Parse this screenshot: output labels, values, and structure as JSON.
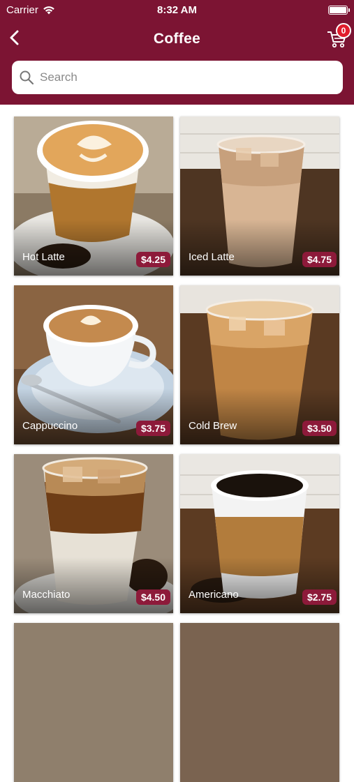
{
  "status_bar": {
    "carrier": "Carrier",
    "time": "8:32 AM"
  },
  "header": {
    "title": "Coffee",
    "cart_count": "0"
  },
  "search": {
    "placeholder": "Search",
    "value": ""
  },
  "colors": {
    "header_bg": "#7c1433",
    "price_bg": "#8d1a3a",
    "badge_bg": "#e11d2c"
  },
  "products": [
    {
      "name": "Hot Latte",
      "price": "$4.25"
    },
    {
      "name": "Iced Latte",
      "price": "$4.75"
    },
    {
      "name": "Cappuccino",
      "price": "$3.75"
    },
    {
      "name": "Cold Brew",
      "price": "$3.50"
    },
    {
      "name": "Macchiato",
      "price": "$4.50"
    },
    {
      "name": "Americano",
      "price": "$2.75"
    }
  ]
}
